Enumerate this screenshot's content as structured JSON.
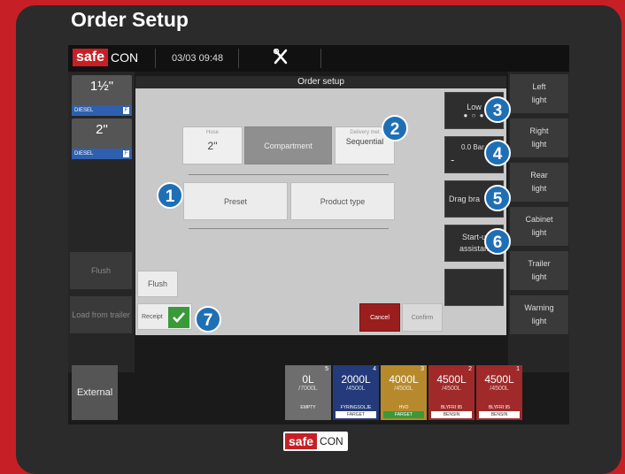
{
  "page_title": "Order Setup",
  "topbar": {
    "brand_left": "safe",
    "brand_right": "CON",
    "datetime": "03/03 09:48"
  },
  "hoses": [
    {
      "size": "1½\"",
      "fuel": "DIESEL",
      "fuel_icon": "F"
    },
    {
      "size": "2\"",
      "fuel": "DIESEL",
      "fuel_icon": "F"
    }
  ],
  "left_buttons": {
    "flush": "Flush",
    "load_from_trailer": "Load from trailer"
  },
  "dialog": {
    "title": "Order setup",
    "hose_label": "Hose",
    "hose_value": "2\"",
    "compartment": "Compartment",
    "delivery_label": "Delivery met",
    "delivery_value": "Sequential",
    "preset": "Preset",
    "product_type": "Product type",
    "flush": "Flush",
    "receipt": "Receipt",
    "cancel": "Cancel",
    "confirm": "Confirm"
  },
  "middle_controls": {
    "low": "Low",
    "pressure": "0.0 Bar",
    "minus": "-",
    "drag_brake": "Drag bra",
    "startup": "Start-u",
    "startup_2": "assistan"
  },
  "right_buttons": [
    {
      "line1": "Left",
      "line2": "light"
    },
    {
      "line1": "Right",
      "line2": "light"
    },
    {
      "line1": "Rear",
      "line2": "light"
    },
    {
      "line1": "Cabinet",
      "line2": "light"
    },
    {
      "line1": "Trailer",
      "line2": "light"
    },
    {
      "line1": "Warning",
      "line2": "light"
    }
  ],
  "external_label": "External",
  "compartments": [
    {
      "num": "5",
      "amount": "0L",
      "capacity": "/7000L",
      "name": "EMPTY",
      "tag": "",
      "color": "#6e6e6e"
    },
    {
      "num": "4",
      "amount": "2000L",
      "capacity": "/4500L",
      "name": "FYRINGSOLJE",
      "tag": "FARGET",
      "color": "#243a7a"
    },
    {
      "num": "3",
      "amount": "4000L",
      "capacity": "/4500L",
      "name": "HVO",
      "tag": "FARGET",
      "color": "#b68a2c"
    },
    {
      "num": "2",
      "amount": "4500L",
      "capacity": "/4500L",
      "name": "BLYFRI 95",
      "tag": "BENSIN",
      "color": "#a02a2a"
    },
    {
      "num": "1",
      "amount": "4500L",
      "capacity": "/4500L",
      "name": "BLYFRI 95",
      "tag": "BENSIN",
      "color": "#a02a2a"
    }
  ],
  "badges": [
    "1",
    "2",
    "3",
    "4",
    "5",
    "6",
    "7"
  ],
  "bottom_logo": {
    "safe": "safe",
    "con": "CON"
  },
  "colors": {
    "brand_red": "#c62026",
    "badge_blue": "#1f6fb5",
    "confirm_green": "#3a9a3a",
    "cancel_red": "#9a1e1e"
  }
}
